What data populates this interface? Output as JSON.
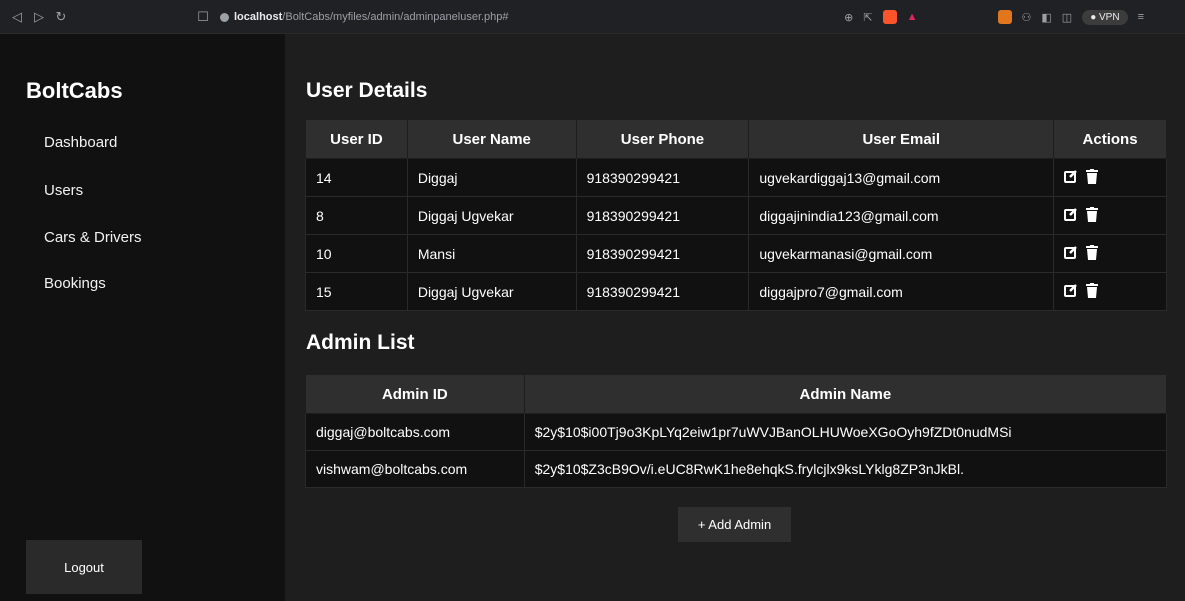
{
  "browser": {
    "url_host": "localhost",
    "url_path": "/BoltCabs/myfiles/admin/adminpaneluser.php#",
    "vpn_label": "VPN"
  },
  "sidebar": {
    "brand": "BoltCabs",
    "items": [
      {
        "label": "Dashboard"
      },
      {
        "label": "Users"
      },
      {
        "label": "Cars & Drivers"
      },
      {
        "label": "Bookings"
      }
    ],
    "logout_label": "Logout"
  },
  "user_details": {
    "title": "User Details",
    "columns": [
      "User ID",
      "User Name",
      "User Phone",
      "User Email",
      "Actions"
    ],
    "rows": [
      {
        "id": "14",
        "name": "Diggaj",
        "phone": "918390299421",
        "email": "ugvekardiggaj13@gmail.com"
      },
      {
        "id": "8",
        "name": "Diggaj Ugvekar",
        "phone": "918390299421",
        "email": "diggajinindia123@gmail.com"
      },
      {
        "id": "10",
        "name": "Mansi",
        "phone": "918390299421",
        "email": "ugvekarmanasi@gmail.com"
      },
      {
        "id": "15",
        "name": "Diggaj Ugvekar",
        "phone": "918390299421",
        "email": "diggajpro7@gmail.com"
      }
    ]
  },
  "admin_list": {
    "title": "Admin List",
    "columns": [
      "Admin ID",
      "Admin Name"
    ],
    "rows": [
      {
        "id": "diggaj@boltcabs.com",
        "name": "$2y$10$i00Tj9o3KpLYq2eiw1pr7uWVJBanOLHUWoeXGoOyh9fZDt0nudMSi"
      },
      {
        "id": "vishwam@boltcabs.com",
        "name": "$2y$10$Z3cB9Ov/i.eUC8RwK1he8ehqkS.frylcjlx9ksLYklg8ZP3nJkBl."
      }
    ],
    "add_label": "+ Add Admin"
  }
}
